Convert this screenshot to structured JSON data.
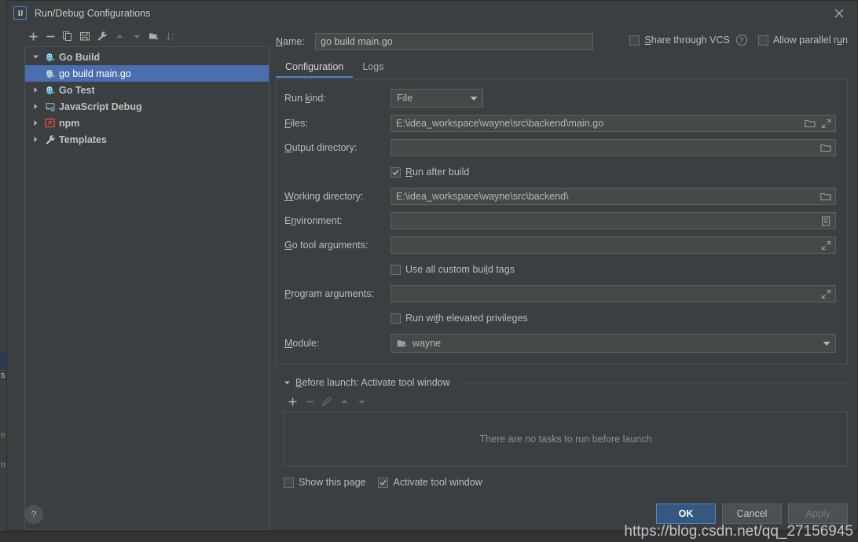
{
  "window": {
    "title": "Run/Debug Configurations",
    "logo_text": "IJ",
    "close_icon": "close-icon"
  },
  "tree_toolbar": {
    "items": [
      {
        "icon": "add-icon",
        "enabled": true
      },
      {
        "icon": "remove-icon",
        "enabled": true
      },
      {
        "icon": "copy-icon",
        "enabled": true
      },
      {
        "icon": "save-icon",
        "enabled": true
      },
      {
        "icon": "wrench-icon",
        "enabled": true
      },
      {
        "icon": "arrow-up-icon",
        "enabled": false
      },
      {
        "icon": "arrow-down-icon",
        "enabled": false
      },
      {
        "icon": "new-folder-icon",
        "enabled": true
      },
      {
        "icon": "sort-alphabetically-icon",
        "enabled": false
      }
    ]
  },
  "tree": {
    "nodes": [
      {
        "label": "Go Build",
        "icon": "go-gopher-icon",
        "expanded": true,
        "group": true,
        "selected": false,
        "child": false
      },
      {
        "label": "go build main.go",
        "icon": "go-gopher-icon",
        "expanded": null,
        "group": false,
        "selected": true,
        "child": true
      },
      {
        "label": "Go Test",
        "icon": "go-gopher-icon",
        "expanded": false,
        "group": true,
        "selected": false,
        "child": false
      },
      {
        "label": "JavaScript Debug",
        "icon": "javascript-debug-icon",
        "expanded": false,
        "group": true,
        "selected": false,
        "child": false
      },
      {
        "label": "npm",
        "icon": "npm-icon",
        "expanded": false,
        "group": true,
        "selected": false,
        "child": false
      },
      {
        "label": "Templates",
        "icon": "wrench-icon",
        "expanded": false,
        "group": true,
        "selected": false,
        "child": false
      }
    ]
  },
  "help_button": {
    "label": "?"
  },
  "name_field": {
    "label": "Name:",
    "value": "go build main.go",
    "placeholder": ""
  },
  "options": {
    "share_vcs": {
      "label": "Share through VCS",
      "checked": false,
      "help": "?"
    },
    "parallel_run": {
      "label": "Allow parallel run",
      "checked": false
    }
  },
  "tabs": [
    {
      "label": "Configuration",
      "active": true
    },
    {
      "label": "Logs",
      "active": false
    }
  ],
  "form": {
    "run_kind": {
      "label": "Run kind:",
      "value": "File"
    },
    "files": {
      "label": "Files:",
      "value": "E:\\idea_workspace\\wayne\\src\\backend\\main.go",
      "icons": [
        "folder-icon",
        "expand-icon"
      ]
    },
    "output_directory": {
      "label": "Output directory:",
      "value": "",
      "icons": [
        "folder-icon"
      ]
    },
    "run_after_build": {
      "label": "Run after build",
      "checked": true
    },
    "working_directory": {
      "label": "Working directory:",
      "value": "E:\\idea_workspace\\wayne\\src\\backend\\",
      "icons": [
        "folder-icon"
      ]
    },
    "environment": {
      "label": "Environment:",
      "value": "",
      "icons": [
        "list-icon"
      ]
    },
    "go_tool_arguments": {
      "label": "Go tool arguments:",
      "value": "",
      "icons": [
        "expand-icon"
      ]
    },
    "use_all_custom_build_tags": {
      "label": "Use all custom build tags",
      "checked": false
    },
    "program_arguments": {
      "label": "Program arguments:",
      "value": "",
      "icons": [
        "expand-icon"
      ]
    },
    "run_with_elevated_privileges": {
      "label": "Run with elevated privileges",
      "checked": false
    },
    "module": {
      "label": "Module:",
      "value": "wayne",
      "icon": "module-folder-icon"
    }
  },
  "before_launch": {
    "title": "Before launch: Activate tool window",
    "toolbar": [
      {
        "icon": "add-icon",
        "enabled": true
      },
      {
        "icon": "remove-icon",
        "enabled": false
      },
      {
        "icon": "edit-pencil-icon",
        "enabled": false
      },
      {
        "icon": "arrow-up-icon",
        "enabled": false
      },
      {
        "icon": "arrow-down-icon",
        "enabled": false
      }
    ],
    "empty_text": "There are no tasks to run before launch",
    "show_this_page": {
      "label": "Show this page",
      "checked": false
    },
    "activate_tool_window": {
      "label": "Activate tool window",
      "checked": true
    }
  },
  "buttons": {
    "ok": "OK",
    "cancel": "Cancel",
    "apply": "Apply"
  },
  "watermark": "https://blog.csdn.net/qq_27156945",
  "colors": {
    "accent_blue": "#4a88c7",
    "selection_blue": "#4b6eaf",
    "default_button_blue": "#365880",
    "panel_bg": "#3c3f41",
    "field_bg": "#45494a"
  }
}
